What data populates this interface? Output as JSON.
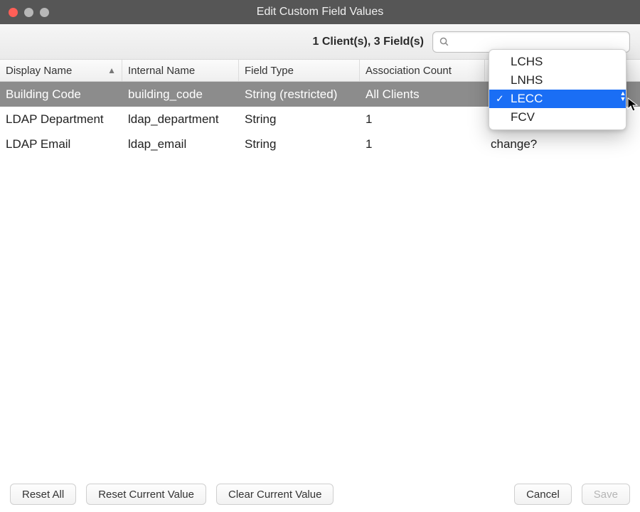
{
  "window": {
    "title": "Edit Custom Field Values"
  },
  "summary": "1 Client(s), 3 Field(s)",
  "search": {
    "value": "",
    "placeholder": ""
  },
  "columns": {
    "display_name": "Display Name",
    "internal_name": "Internal Name",
    "field_type": "Field Type",
    "association_count": "Association Count",
    "value": ""
  },
  "rows": [
    {
      "display_name": "Building Code",
      "internal_name": "building_code",
      "field_type": "String (restricted)",
      "association_count": "All Clients",
      "value": "",
      "selected": true
    },
    {
      "display_name": "LDAP Department",
      "internal_name": "ldap_department",
      "field_type": "String",
      "association_count": "1",
      "value": ""
    },
    {
      "display_name": "LDAP Email",
      "internal_name": "ldap_email",
      "field_type": "String",
      "association_count": "1",
      "value": "change?"
    }
  ],
  "dropdown": {
    "options": [
      "LCHS",
      "LNHS",
      "LECC",
      "FCV"
    ],
    "selected": "LECC"
  },
  "footer": {
    "reset_all": "Reset All",
    "reset_current": "Reset Current Value",
    "clear_current": "Clear Current Value",
    "cancel": "Cancel",
    "save": "Save"
  },
  "colors": {
    "selection_row": "#8c8c8c",
    "selection_menu": "#1a6ef5"
  }
}
